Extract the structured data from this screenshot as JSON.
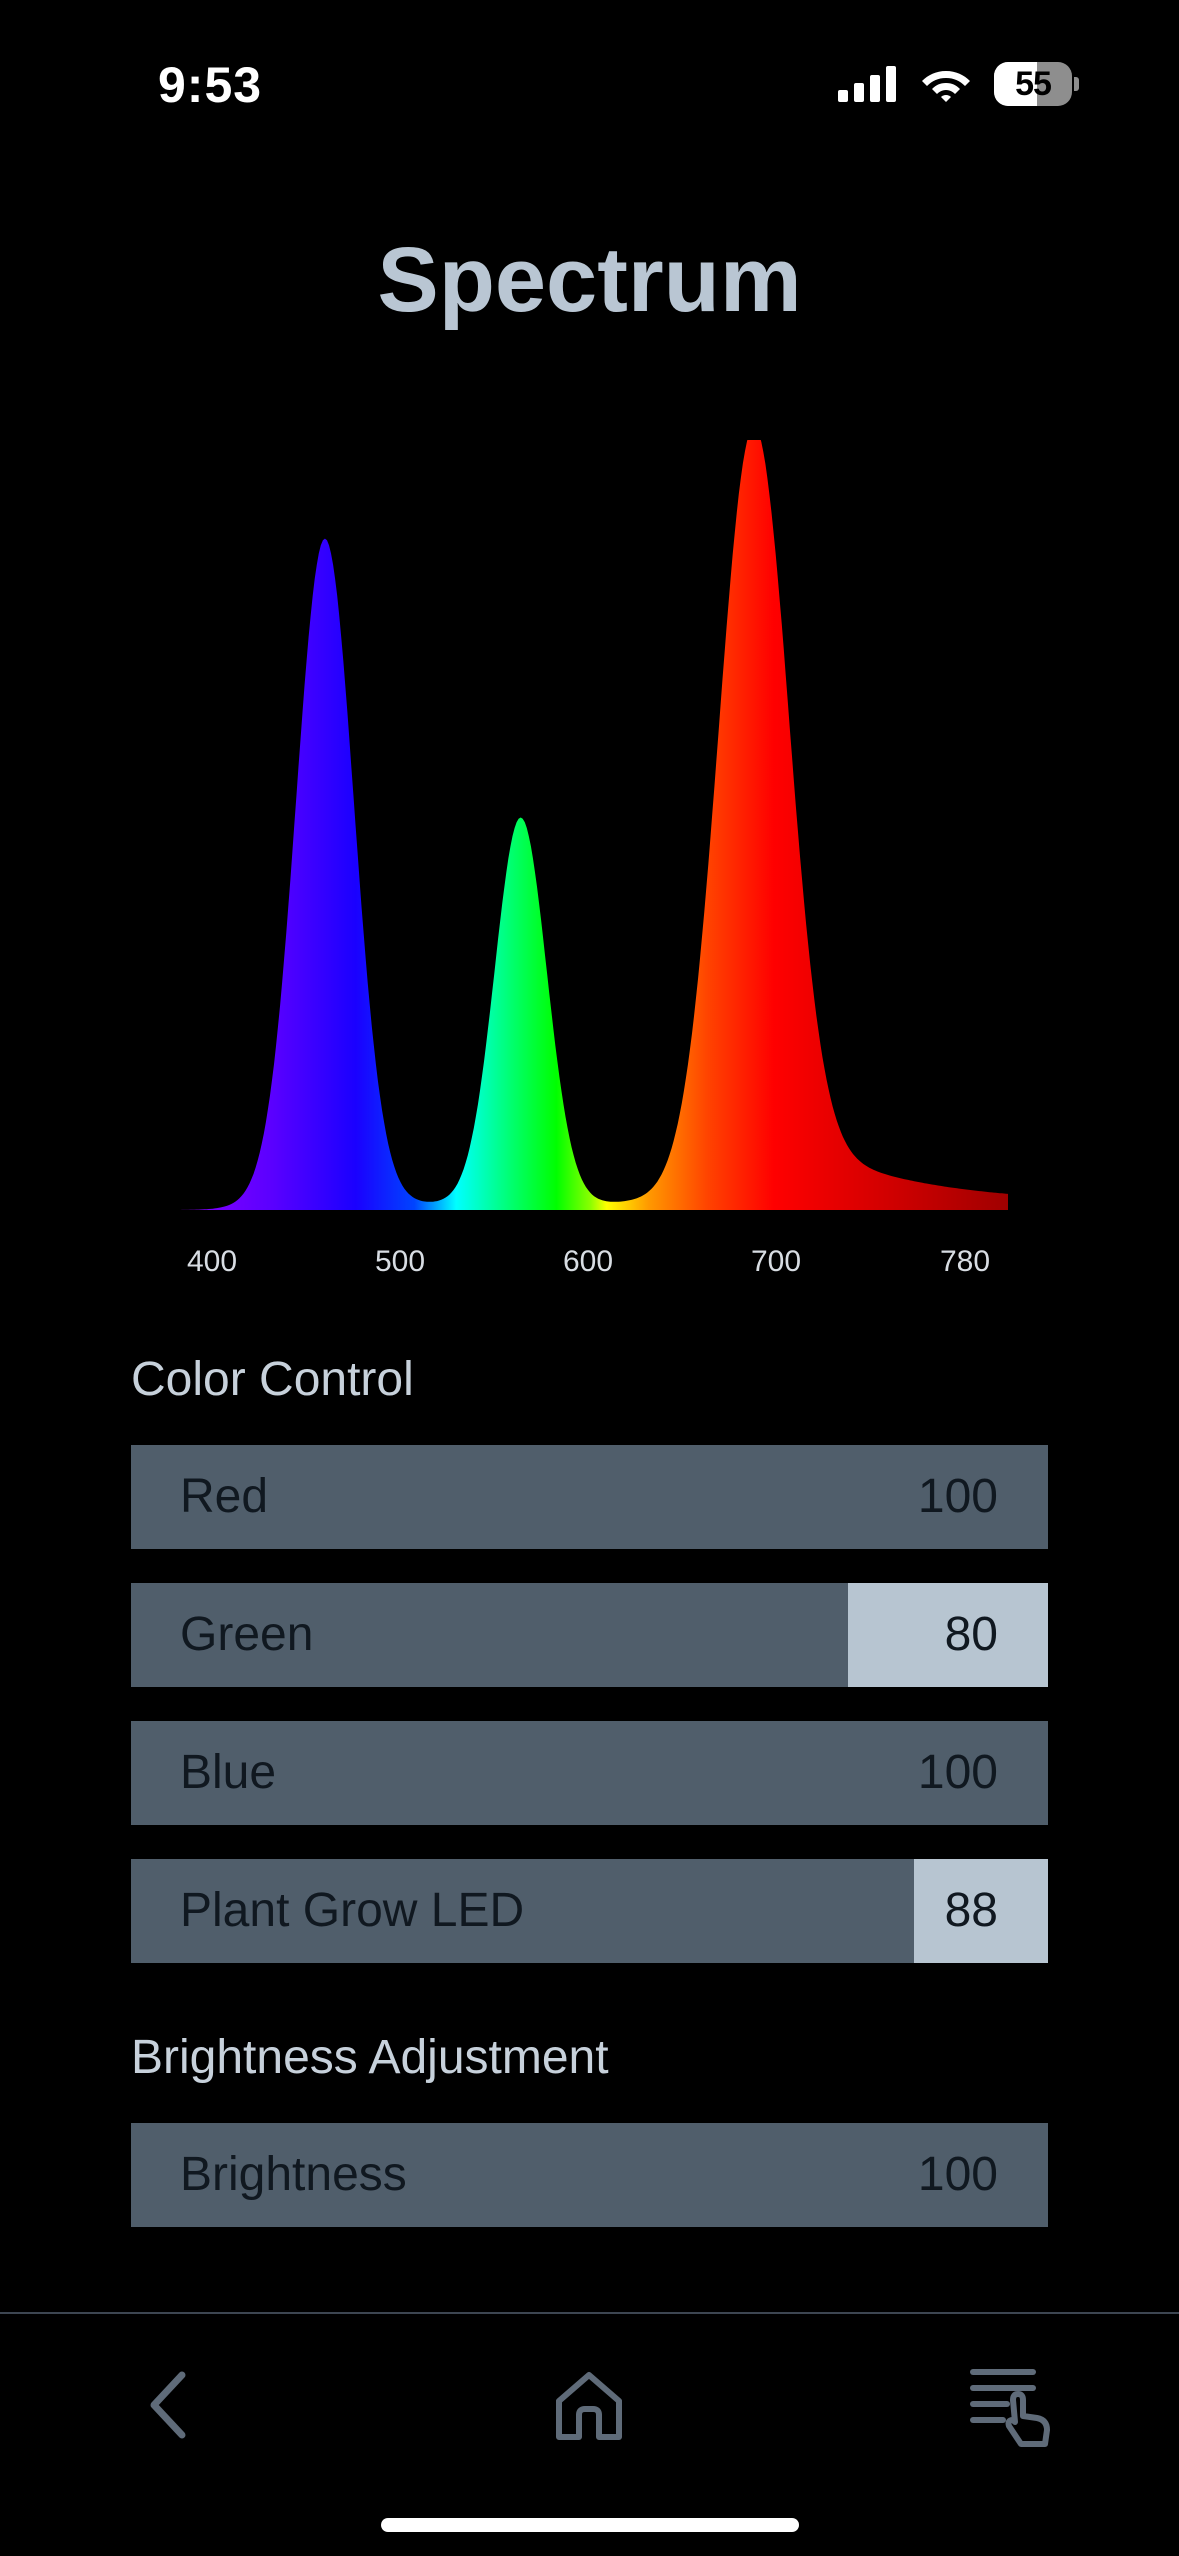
{
  "status_bar": {
    "time": "9:53",
    "battery_level": "55",
    "battery_fraction": 0.55,
    "icons": [
      "cellular-signal-icon",
      "wifi-icon",
      "battery-icon"
    ]
  },
  "title": "Spectrum",
  "chart_data": {
    "type": "area",
    "title": "",
    "xlabel": "",
    "ylabel": "",
    "x_ticks": [
      "400",
      "500",
      "600",
      "700",
      "780"
    ],
    "xlim": [
      380,
      790
    ],
    "ylim": [
      0,
      1.0
    ],
    "peaks": [
      {
        "wavelength": 455,
        "relative_height": 0.93
      },
      {
        "wavelength": 551,
        "relative_height": 0.54
      },
      {
        "wavelength": 665,
        "relative_height": 1.0
      }
    ],
    "fill": "visible-spectrum-gradient",
    "grid": false
  },
  "color_control": {
    "title": "Color Control",
    "sliders": [
      {
        "label": "Red",
        "value": "100",
        "level": 1.0
      },
      {
        "label": "Green",
        "value": "80",
        "level": 0.8
      },
      {
        "label": "Blue",
        "value": "100",
        "level": 1.0
      },
      {
        "label": "Plant Grow LED",
        "value": "88",
        "level": 0.88
      }
    ]
  },
  "brightness": {
    "title": "Brightness Adjustment",
    "slider": {
      "label": "Brightness",
      "value": "100",
      "level": 1.0
    }
  },
  "bottom_nav": {
    "items": [
      "back-icon",
      "home-icon",
      "menu-touch-icon"
    ]
  },
  "colors": {
    "background": "#000000",
    "title": "#b9c6d3",
    "slider_track": "#505e6b",
    "slider_knob": "#b7c5d1",
    "nav_icon": "#5f6b79"
  }
}
